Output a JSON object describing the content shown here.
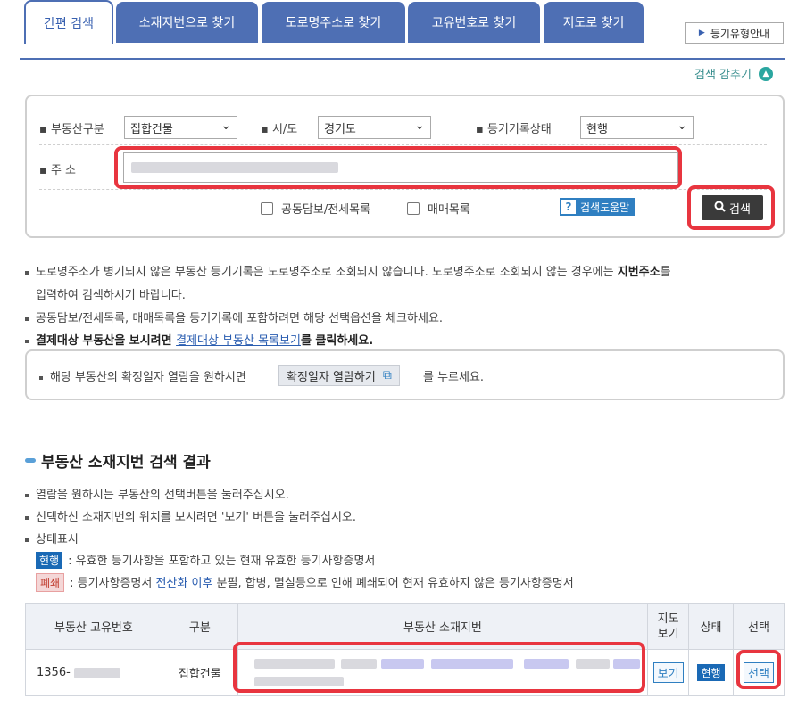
{
  "tabs": [
    "간편 검색",
    "소재지번으로 찾기",
    "도로명주소로 찾기",
    "고유번호로 찾기",
    "지도로 찾기"
  ],
  "guide_button": "등기유형안내",
  "collapse_label": "검색 감추기",
  "form": {
    "property_type_label": "부동산구분",
    "property_type_value": "집합건물",
    "region_label": "시/도",
    "region_value": "경기도",
    "status_label": "등기기록상태",
    "status_value": "현행",
    "address_label": "주 소",
    "checkbox_joint": "공동담보/전세목록",
    "checkbox_sale": "매매목록",
    "help_button": "검색도움말",
    "search_button": "검색"
  },
  "notes": {
    "n1_a": "도로명주소가 병기되지 않은 부동산 등기기록은 도로명주소로 조회되지 않습니다. 도로명주소로 조회되지 않는 경우에는 ",
    "n1_b": "지번주소",
    "n1_c": "를",
    "n1_d": "입력하여 검색하시기 바랍니다.",
    "n2": "공동담보/전세목록, 매매목록을 등기기록에 포함하려면 해당 선택옵션을 체크하세요.",
    "n3_a": "결제대상 부동산을 보시려면 ",
    "n3_link": "결제대상 부동산 목록보기",
    "n3_c": "를 클릭하세요."
  },
  "infobox": {
    "text_a": "해당 부동산의 확정일자 열람을 원하시면",
    "button": "확정일자 열람하기",
    "text_b": "를 누르세요."
  },
  "results": {
    "title": "부동산 소재지번 검색 결과",
    "r1": "열람을 원하시는 부동산의 선택버튼을 눌러주십시오.",
    "r2": "선택하신 소재지번의 위치를 보시려면 '보기' 버튼을 눌러주십시오.",
    "r3": "상태표시",
    "badge_current": "현행",
    "badge_current_desc": ": 유효한 등기사항을 포함하고 있는 현재 유효한 등기사항증명서",
    "badge_closed": "폐쇄",
    "badge_closed_desc_a": ": 등기사항증명서 ",
    "badge_closed_desc_link": "전산화 이후",
    "badge_closed_desc_b": " 분필, 합병, 멸실등으로 인해 폐쇄되어 현재 유효하지 않은 등기사항증명서"
  },
  "table": {
    "headers": [
      "부동산 고유번호",
      "구분",
      "부동산 소재지번",
      "지도\n보기",
      "상태",
      "선택"
    ],
    "row": {
      "id": "1356-",
      "type": "집합건물",
      "view": "보기",
      "status": "현행",
      "select": "선택"
    }
  },
  "colors": {
    "tab_blue": "#4e6fb4",
    "highlight_red": "#e8353f",
    "badge_blue": "#1a69b5"
  }
}
